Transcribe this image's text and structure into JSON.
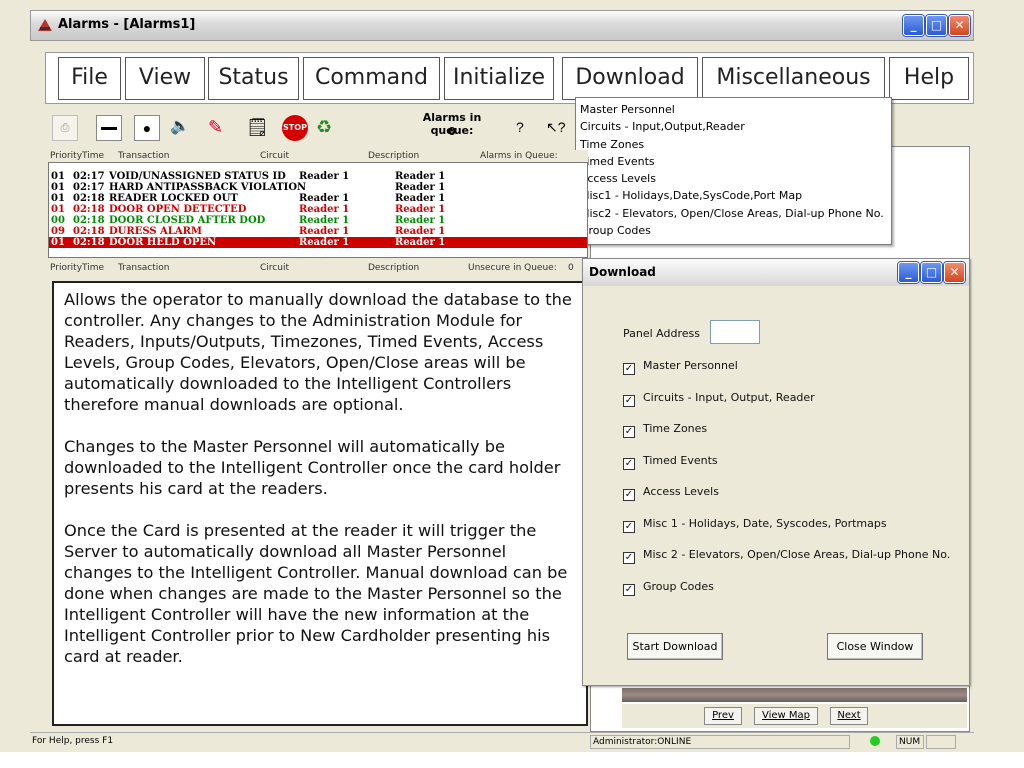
{
  "window": {
    "title": "Alarms - [Alarms1]"
  },
  "menu": [
    "File",
    "View",
    "Status",
    "Command",
    "Initialize",
    "Download",
    "Miscellaneous",
    "Help"
  ],
  "download_menu": [
    "Master Personnel",
    "Circuits - Input,Output,Reader",
    "Time Zones",
    "Timed Events",
    "Access Levels",
    "Misc1 - Holidays,Date,SysCode,Port Map",
    "Misc2 - Elevators, Open/Close Areas, Dial-up Phone No.",
    "Group Codes"
  ],
  "toolbar": {
    "queue_label": "Alarms in queue:",
    "queue_count": "0"
  },
  "alarm_header": {
    "priority": "Priority",
    "time": "Time",
    "transaction": "Transaction",
    "circuit": "Circuit",
    "description": "Description",
    "queue_label": "Alarms in Queue:"
  },
  "alarms": [
    {
      "priority": "01",
      "time": "02:17",
      "transaction": "VOID/UNASSIGNED STATUS ID",
      "circuit": "Reader 1",
      "description": "Reader 1",
      "color": "#000000"
    },
    {
      "priority": "01",
      "time": "02:17",
      "transaction": "HARD ANTIPASSBACK VIOLATION",
      "circuit": "",
      "description": "Reader 1",
      "color": "#000000"
    },
    {
      "priority": "01",
      "time": "02:18",
      "transaction": "READER LOCKED OUT",
      "circuit": "Reader 1",
      "description": "Reader 1",
      "color": "#000000"
    },
    {
      "priority": "01",
      "time": "02:18",
      "transaction": "DOOR OPEN DETECTED",
      "circuit": "Reader 1",
      "description": "Reader 1",
      "color": "#d40000"
    },
    {
      "priority": "00",
      "time": "02:18",
      "transaction": "DOOR CLOSED AFTER DOD",
      "circuit": "Reader 1",
      "description": "Reader 1",
      "color": "#008a00"
    },
    {
      "priority": "09",
      "time": "02:18",
      "transaction": "DURESS ALARM",
      "circuit": "Reader 1",
      "description": "Reader 1",
      "color": "#d40000"
    },
    {
      "priority": "01",
      "time": "02:18",
      "transaction": "DOOR HELD OPEN",
      "circuit": "Reader 1",
      "description": "Reader 1",
      "color": "#ffffff",
      "selected": true
    }
  ],
  "unsecure_header": {
    "priority": "Priority",
    "time": "Time",
    "transaction": "Transaction",
    "circuit": "Circuit",
    "description": "Description",
    "queue_label": "Unsecure in Queue:",
    "queue_count": "0"
  },
  "description_text": [
    "Allows the operator to manually download the database to the controller. Any changes to the Administration Module for Readers, Inputs/Outputs, Timezones, Timed Events, Access Levels, Group Codes, Elevators, Open/Close areas will be automatically downloaded to the Intelligent Controllers therefore manual downloads are optional.",
    "Changes to the Master Personnel will automatically be downloaded to the Intelligent Controller once the card holder presents his card at the readers.",
    "Once the Card is presented at the reader it will trigger the Server to automatically download all Master Personnel changes to the Intelligent Controller. Manual download can be done when changes are made to the Master Personnel so the Intelligent Controller will have the new information at the Intelligent Controller prior to New Cardholder presenting his card at reader."
  ],
  "dialog": {
    "title": "Download",
    "panel_address_label": "Panel Address",
    "panel_address_value": "",
    "options": [
      {
        "label": "Master Personnel",
        "checked": true
      },
      {
        "label": "Circuits - Input, Output, Reader",
        "checked": true
      },
      {
        "label": "Time Zones",
        "checked": true
      },
      {
        "label": "Timed Events",
        "checked": true
      },
      {
        "label": "Access Levels",
        "checked": true
      },
      {
        "label": "Misc 1 - Holidays, Date, Syscodes, Portmaps",
        "checked": true
      },
      {
        "label": "Misc 2 - Elevators, Open/Close Areas, Dial-up Phone No.",
        "checked": true
      },
      {
        "label": "Group Codes",
        "checked": true
      }
    ],
    "start_button": "Start Download",
    "close_button": "Close Window"
  },
  "map_nav": {
    "prev": "Prev",
    "view_map": "View Map",
    "next": "Next"
  },
  "status": {
    "help": "For Help, press F1",
    "user": "Administrator:ONLINE",
    "num": "NUM"
  },
  "colors": {
    "selected_row": "#cc0000",
    "status_led": "#22cc22"
  }
}
